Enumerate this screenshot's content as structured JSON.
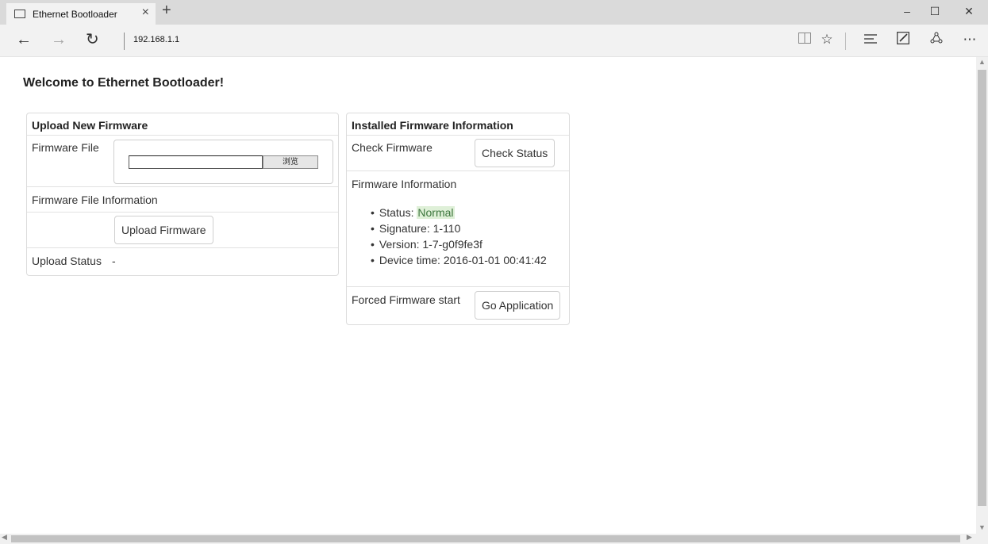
{
  "browser": {
    "tab_title": "Ethernet Bootloader",
    "tab_close": "×",
    "new_tab": "+",
    "url": "192.168.1.1",
    "window_controls": {
      "minimize": "–",
      "maximize": "☐",
      "close": "✕"
    },
    "nav": {
      "back": "←",
      "forward": "→",
      "refresh": "↻"
    },
    "tools": [
      "reading-view-icon",
      "favorite-star-icon",
      "hub-icon",
      "web-note-icon",
      "share-icon",
      "more-icon"
    ]
  },
  "page": {
    "title": "Welcome to Ethernet Bootloader!",
    "upload_panel": {
      "heading": "Upload New Firmware",
      "file_label": "Firmware File",
      "browse_label": "浏览",
      "file_info_label": "Firmware File Information",
      "upload_button": "Upload Firmware",
      "status_label": "Upload Status",
      "status_value": "-"
    },
    "installed_panel": {
      "heading": "Installed Firmware Information",
      "check_label": "Check Firmware",
      "check_button": "Check Status",
      "info_label": "Firmware Information",
      "status_prefix": "Status:",
      "status_value": "Normal",
      "signature": "Signature: 1-110",
      "version": "Version: 1-7-g0f9fe3f",
      "device_time": "Device time: 2016-01-01 00:41:42",
      "forced_label": "Forced Firmware start",
      "go_button": "Go Application"
    }
  },
  "colors": {
    "status_ok_bg": "#dff0d8",
    "status_ok_text": "#3c763d"
  }
}
